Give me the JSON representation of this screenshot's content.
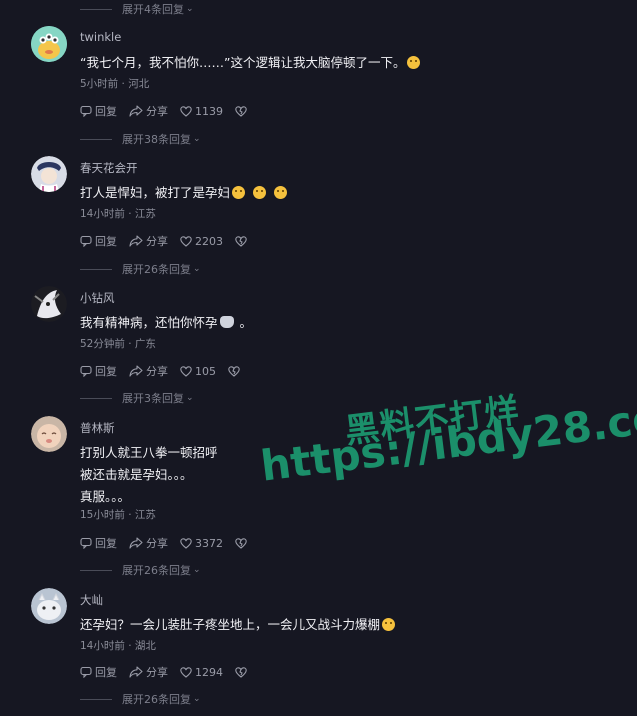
{
  "expanders": [
    {
      "label": "展开4条回复"
    },
    {
      "label": "展开38条回复"
    },
    {
      "label": "展开26条回复"
    },
    {
      "label": "展开3条回复"
    },
    {
      "label": "展开26条回复"
    },
    {
      "label": "展开26条回复"
    }
  ],
  "actions": {
    "reply": "回复",
    "share": "分享"
  },
  "comments": [
    {
      "author": "twinkle",
      "lines": [
        "“我七个月，我不怕你……”这个逻辑让我大脑停顿了一下。"
      ],
      "emojis": [
        "dizzy-face"
      ],
      "meta": "5小时前 · 河北",
      "likes": "1139"
    },
    {
      "author": "春天花会开",
      "lines": [
        "打人是悍妇，被打了是孕妇"
      ],
      "emojis": [
        "laughing",
        "laughing",
        "laughing"
      ],
      "meta": "14小时前 · 江苏",
      "likes": "2203"
    },
    {
      "author": "小钻风",
      "lines": [
        "我有精神病，还怕你怀孕",
        "。"
      ],
      "emojis": [
        "cat"
      ],
      "meta": "52分钟前 · 广东",
      "likes": "105"
    },
    {
      "author": "普林斯",
      "lines": [
        "打别人就王八拳一顿招呼",
        "被还击就是孕妇。。。",
        "真服。。。"
      ],
      "emojis": [],
      "meta": "15小时前 · 江苏",
      "likes": "3372"
    },
    {
      "author": "大屾",
      "lines": [
        "还孕妇？一会儿装肚子疼坐地上，一会儿又战斗力爆棚"
      ],
      "emojis": [
        "laughing"
      ],
      "meta": "14小时前 · 湖北",
      "likes": "1294"
    }
  ],
  "watermark": {
    "line1": "黑料不打烊",
    "line2": "https://ibdy28.com"
  }
}
